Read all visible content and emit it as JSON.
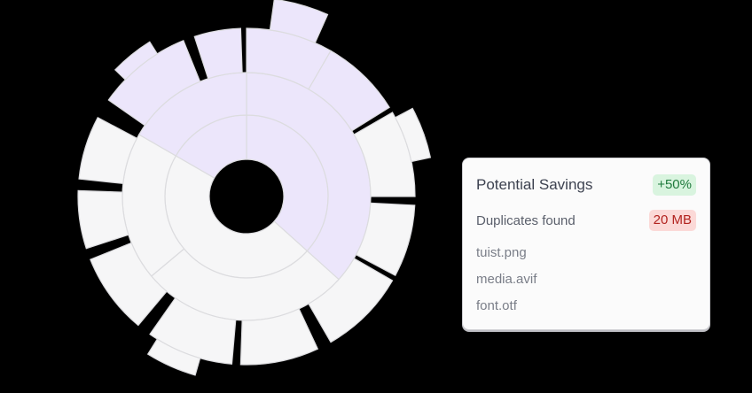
{
  "savings_card": {
    "title": "Potential Savings",
    "savings_badge": "+50%",
    "duplicates_label": "Duplicates found",
    "duplicates_badge": "20 MB",
    "files": [
      "tuist.png",
      "media.avif",
      "font.otf"
    ]
  },
  "colors": {
    "segment_fill": "#f6f6f7",
    "segment_stroke": "#dcdcdf",
    "highlight_fill": "#ece6fb",
    "savings_green": "#1f7a3c",
    "duplicates_red": "#b2231f"
  },
  "icons": {
    "chart": "sunburst-chart"
  }
}
